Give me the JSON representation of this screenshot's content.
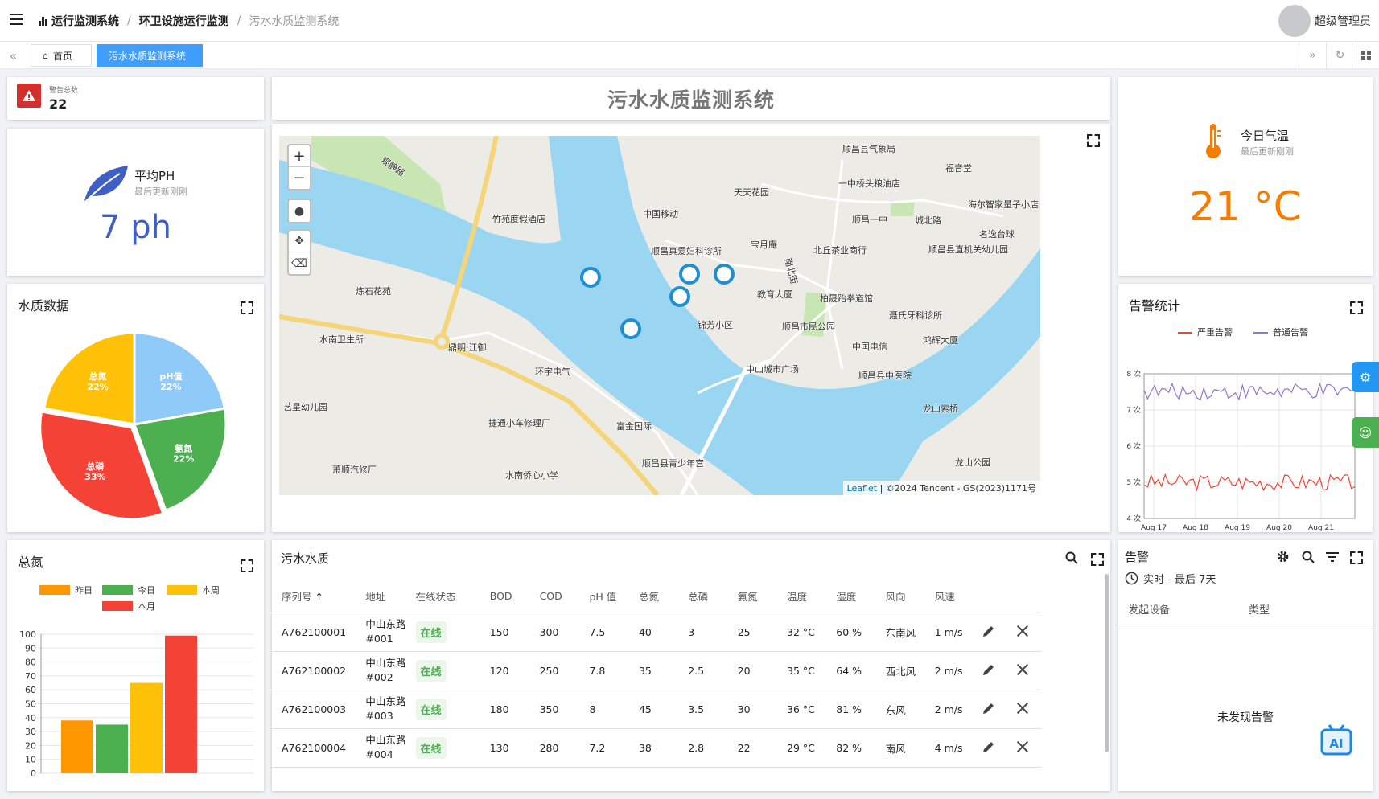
{
  "header": {
    "breadcrumb": [
      "运行监测系统",
      "环卫设施运行监测",
      "污水水质监测系统"
    ],
    "user": "超级管理员"
  },
  "tabs": {
    "home": "首页",
    "active": "污水水质监测系统"
  },
  "warning": {
    "label": "警告总数",
    "value": "22"
  },
  "ph_card": {
    "title": "平均PH",
    "subtitle": "最后更新刚刚",
    "value": "7 ph"
  },
  "temp_card": {
    "title": "今日气温",
    "subtitle": "最后更新刚刚",
    "value": "21 °C"
  },
  "main_title": "污水水质监测系统",
  "map": {
    "attribution_leaflet": "Leaflet",
    "attribution_rest": "| ©2024 Tencent - GS(2023)1171号",
    "labels": [
      "顺昌县气象局",
      "福音堂",
      "一中桥头粮油店",
      "天天花园",
      "竹苑度假酒店",
      "中国移动",
      "海尔智家量子小店",
      "顺昌一中",
      "城北路",
      "宝月庵",
      "北丘茶业商行",
      "顺昌县直机关幼儿园",
      "名逸台球",
      "顺昌真爱妇科诊所",
      "炼石花苑",
      "教育大厦",
      "柏晟跆拳道馆",
      "聂氏牙科诊所",
      "锦芳小区",
      "顺昌市民公园",
      "鸿辉大厦",
      "水南卫生所",
      "鼎明·江御",
      "中国电信",
      "中山城市广场",
      "顺昌县中医院",
      "环宇电气",
      "艺星幼儿园",
      "龙山索桥",
      "捷通小车修理厂",
      "富金国际",
      "萧顺汽修厂",
      "顺昌县青少年宫",
      "水南侨心小学",
      "龙山公园",
      "观静路",
      "南北街"
    ]
  },
  "water_quality": {
    "title": "水质数据"
  },
  "alarm_stats": {
    "title": "告警统计",
    "legend": [
      "严重告警",
      "普通告警"
    ],
    "y_ticks": [
      "8 次",
      "7 次",
      "6 次",
      "5 次",
      "4 次"
    ],
    "x_ticks": [
      "Aug 17",
      "Aug 18",
      "Aug 19",
      "Aug 20",
      "Aug 21"
    ]
  },
  "nitrogen": {
    "title": "总氮",
    "legend": [
      "昨日",
      "今日",
      "本周",
      "本月"
    ],
    "y_ticks": [
      "100",
      "90",
      "80",
      "70",
      "60",
      "50",
      "40",
      "30",
      "20",
      "10",
      "0"
    ]
  },
  "table": {
    "title": "污水水质",
    "headers": [
      "序列号",
      "地址",
      "在线状态",
      "BOD",
      "COD",
      "pH 值",
      "总氮",
      "总磷",
      "氨氮",
      "温度",
      "湿度",
      "风向",
      "风速"
    ],
    "rows": [
      [
        "A762100001",
        "中山东路",
        "#001",
        "在线",
        "150",
        "300",
        "7.5",
        "40",
        "3",
        "25",
        "32 °C",
        "60 %",
        "东南风",
        "1 m/s"
      ],
      [
        "A762100002",
        "中山东路",
        "#002",
        "在线",
        "120",
        "250",
        "7.8",
        "35",
        "2.5",
        "20",
        "35 °C",
        "64 %",
        "西北风",
        "2 m/s"
      ],
      [
        "A762100003",
        "中山东路",
        "#003",
        "在线",
        "180",
        "350",
        "8",
        "45",
        "3.5",
        "30",
        "36 °C",
        "81 %",
        "东风",
        "2 m/s"
      ],
      [
        "A762100004",
        "中山东路",
        "#004",
        "在线",
        "130",
        "280",
        "7.2",
        "38",
        "2.8",
        "22",
        "29 °C",
        "82 %",
        "南风",
        "4 m/s"
      ]
    ]
  },
  "alerts": {
    "title": "告警",
    "filter": "实时 - 最后 7天",
    "col1": "发起设备",
    "col2": "类型",
    "empty": "未发现告警"
  },
  "chart_data": [
    {
      "type": "pie",
      "title": "水质数据",
      "labels": [
        "pH值",
        "氨氮",
        "总磷",
        "总氮"
      ],
      "values": [
        22,
        22,
        33,
        22
      ],
      "colors": [
        "#90caf9",
        "#4caf50",
        "#f44336",
        "#ffc107"
      ]
    },
    {
      "type": "bar",
      "title": "总氮",
      "categories": [
        "昨日",
        "今日",
        "本周",
        "本月"
      ],
      "values": [
        38,
        35,
        65,
        99
      ],
      "colors": [
        "#ff9800",
        "#4caf50",
        "#ffc107",
        "#f44336"
      ],
      "ylim": [
        0,
        100
      ]
    },
    {
      "type": "line",
      "title": "告警统计",
      "x": [
        "Aug 17",
        "Aug 18",
        "Aug 19",
        "Aug 20",
        "Aug 21"
      ],
      "ylim": [
        4,
        8
      ],
      "series": [
        {
          "name": "严重告警",
          "color": "#f44336",
          "level": 5
        },
        {
          "name": "普通告警",
          "color": "#9575cd",
          "level": 7.5
        }
      ]
    }
  ]
}
